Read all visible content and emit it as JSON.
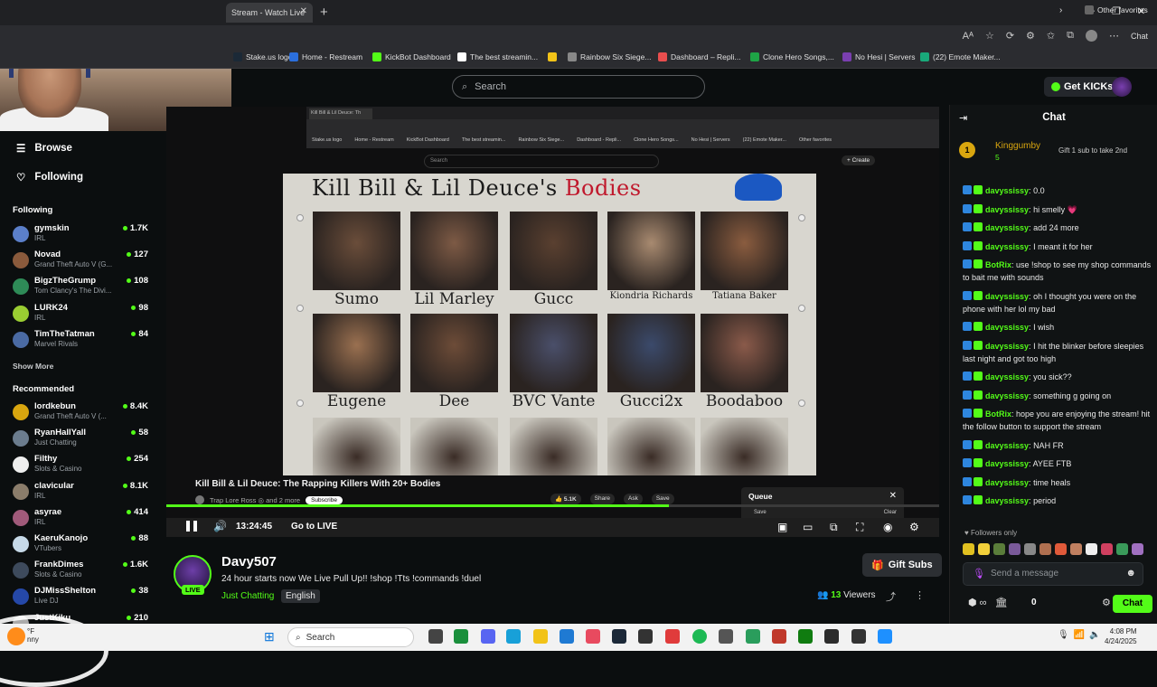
{
  "browser": {
    "tab_title": "Stream - Watch Live",
    "bookmarks": [
      {
        "label": "Stake.us logo",
        "color": "#1b2937"
      },
      {
        "label": "Home - Restream",
        "color": "#2b6fdc"
      },
      {
        "label": "KickBot Dashboard",
        "color": "#53fc18"
      },
      {
        "label": "The best streamin...",
        "color": "#ffffff"
      },
      {
        "label": "",
        "color": "#f2c318"
      },
      {
        "label": "Rainbow Six Siege...",
        "color": "#888888"
      },
      {
        "label": "Dashboard – Repli...",
        "color": "#e94e4e"
      },
      {
        "label": "Clone Hero Songs,...",
        "color": "#1ea446"
      },
      {
        "label": "No Hesi | Servers",
        "color": "#7a3fb0"
      },
      {
        "label": "(22) Emote Maker...",
        "color": "#19a97a"
      }
    ],
    "other_favorites": "Other favorites",
    "chat_label": "Chat"
  },
  "header": {
    "search_placeholder": "Search",
    "get_kicks": "Get KICKs"
  },
  "sidebar": {
    "browse": "Browse",
    "following": "Following",
    "following_head": "Following",
    "following_channels": [
      {
        "name": "gymskin",
        "category": "IRL",
        "viewers": "1.7K",
        "color": "#5b7fc9"
      },
      {
        "name": "Novad",
        "category": "Grand Theft Auto V (G...",
        "viewers": "127",
        "color": "#8a5a3c"
      },
      {
        "name": "BigzTheGrump",
        "category": "Tom Clancy's The Divi...",
        "viewers": "108",
        "color": "#2e8b57"
      },
      {
        "name": "LURK24",
        "category": "IRL",
        "viewers": "98",
        "color": "#9acd32"
      },
      {
        "name": "TimTheTatman",
        "category": "Marvel Rivals",
        "viewers": "84",
        "color": "#4a6aa3"
      }
    ],
    "show_more": "Show More",
    "recommended_head": "Recommended",
    "recommended_channels": [
      {
        "name": "lordkebun",
        "category": "Grand Theft Auto V (...",
        "viewers": "8.4K",
        "color": "#d9a60f"
      },
      {
        "name": "RyanHallYall",
        "category": "Just Chatting",
        "viewers": "58",
        "color": "#6b7c8e"
      },
      {
        "name": "Filthy",
        "category": "Slots & Casino",
        "viewers": "254",
        "color": "#eeeeee"
      },
      {
        "name": "clavicular",
        "category": "IRL",
        "viewers": "8.1K",
        "color": "#8b7d6b"
      },
      {
        "name": "asyrae",
        "category": "IRL",
        "viewers": "414",
        "color": "#a05a7a"
      },
      {
        "name": "KaeruKanojo",
        "category": "VTubers",
        "viewers": "88",
        "color": "#c6d9e8"
      },
      {
        "name": "FrankDimes",
        "category": "Slots & Casino",
        "viewers": "1.6K",
        "color": "#3d4a5c"
      },
      {
        "name": "DJMissShelton",
        "category": "Live DJ",
        "viewers": "38",
        "color": "#2548a8"
      },
      {
        "name": "JustKiku",
        "category": "",
        "viewers": "210",
        "color": "#aaaaaa"
      }
    ]
  },
  "video": {
    "inner_tab": "Kill Bill & Lil Deuce: Th",
    "inner_bookmarks": [
      "Stake.us logo",
      "Home - Restream",
      "KickBot Dashboard",
      "The best streamin...",
      "Rainbow Six Siege...",
      "Dashboard - Repli...",
      "Clone Hero Songs...",
      "No Hesi | Servers",
      "(22) Emote Maker...",
      "Other favorites"
    ],
    "inner_search": "Search",
    "inner_create": "+ Create",
    "thumb_title_a": "Kill Bill & Lil Deuce's",
    "thumb_title_b": "Bodies",
    "people": [
      {
        "name": "Sumo",
        "tone": "#6a4d3a"
      },
      {
        "name": "Lil Marley",
        "tone": "#7d5a45"
      },
      {
        "name": "Gucc",
        "tone": "#5a4030"
      },
      {
        "name": "Kiondria Richards",
        "tone": "#a88a70"
      },
      {
        "name": "Tatiana Baker",
        "tone": "#8a5c3f"
      },
      {
        "name": "Eugene",
        "tone": "#9a7050"
      },
      {
        "name": "Dee",
        "tone": "#6d4c38"
      },
      {
        "name": "BVC Vante",
        "tone": "#4a4f6a"
      },
      {
        "name": "Gucci2x",
        "tone": "#3b4a6b"
      },
      {
        "name": "Boodaboo",
        "tone": "#8a5a4a"
      }
    ],
    "yt_video_title": "Kill Bill & Lil Deuce: The Rapping Killers With 20+ Bodies",
    "yt_channel": "Trap Lore Ross ◎ and 2 more",
    "yt_subscribe": "Subscribe",
    "yt_likes": "5.1K",
    "yt_share": "Share",
    "yt_ask": "Ask",
    "yt_save": "Save",
    "queue_label": "Queue",
    "queue_save": "Save",
    "queue_clear": "Clear",
    "progress": 0.65,
    "timecode": "13:24:45",
    "go_live": "Go to LIVE"
  },
  "stream": {
    "streamer": "Davy507",
    "live": "LIVE",
    "title": "24 hour starts now We Live Pull Up!! !shop !Tts !commands !duel",
    "category": "Just Chatting",
    "language": "English",
    "gift_subs": "Gift Subs",
    "viewers_count": "13",
    "viewers_label": "Viewers"
  },
  "chat": {
    "title": "Chat",
    "pinned_name": "Kinggumby",
    "pinned_count": "5",
    "pinned_badge": "1",
    "pinned_text": "Gift 1 sub to take 2nd",
    "messages": [
      {
        "user": "davyssissy",
        "text": "0.0"
      },
      {
        "user": "davyssissy",
        "text": "hi smelly 💗"
      },
      {
        "user": "davyssissy",
        "text": "add 24 more"
      },
      {
        "user": "davyssissy",
        "text": "I meant it for her"
      },
      {
        "user": "BotRix",
        "text": "use !shop to see my shop commands to bait me with sounds"
      },
      {
        "user": "davyssissy",
        "text": "oh I thought you were on the phone with her lol my bad"
      },
      {
        "user": "davyssissy",
        "text": "I wish"
      },
      {
        "user": "davyssissy",
        "text": "I hit the blinker before sleepies last night and got too high"
      },
      {
        "user": "davyssissy",
        "text": "you sick??"
      },
      {
        "user": "davyssissy",
        "text": "something g going on"
      },
      {
        "user": "BotRix",
        "text": "hope you are enjoying the stream! hit the follow button to support the stream"
      },
      {
        "user": "davyssissy",
        "text": "NAH FR"
      },
      {
        "user": "davyssissy",
        "text": "AYEE FTB"
      },
      {
        "user": "davyssissy",
        "text": "time heals"
      },
      {
        "user": "davyssissy",
        "text": "period"
      }
    ],
    "followers_only": "Followers only",
    "input_placeholder": "Send a message",
    "points": "0",
    "send_label": "Chat"
  },
  "taskbar": {
    "temp": "°F",
    "sub": "nny",
    "search": "Search",
    "time": "4:08 PM",
    "date": "4/24/2025"
  }
}
